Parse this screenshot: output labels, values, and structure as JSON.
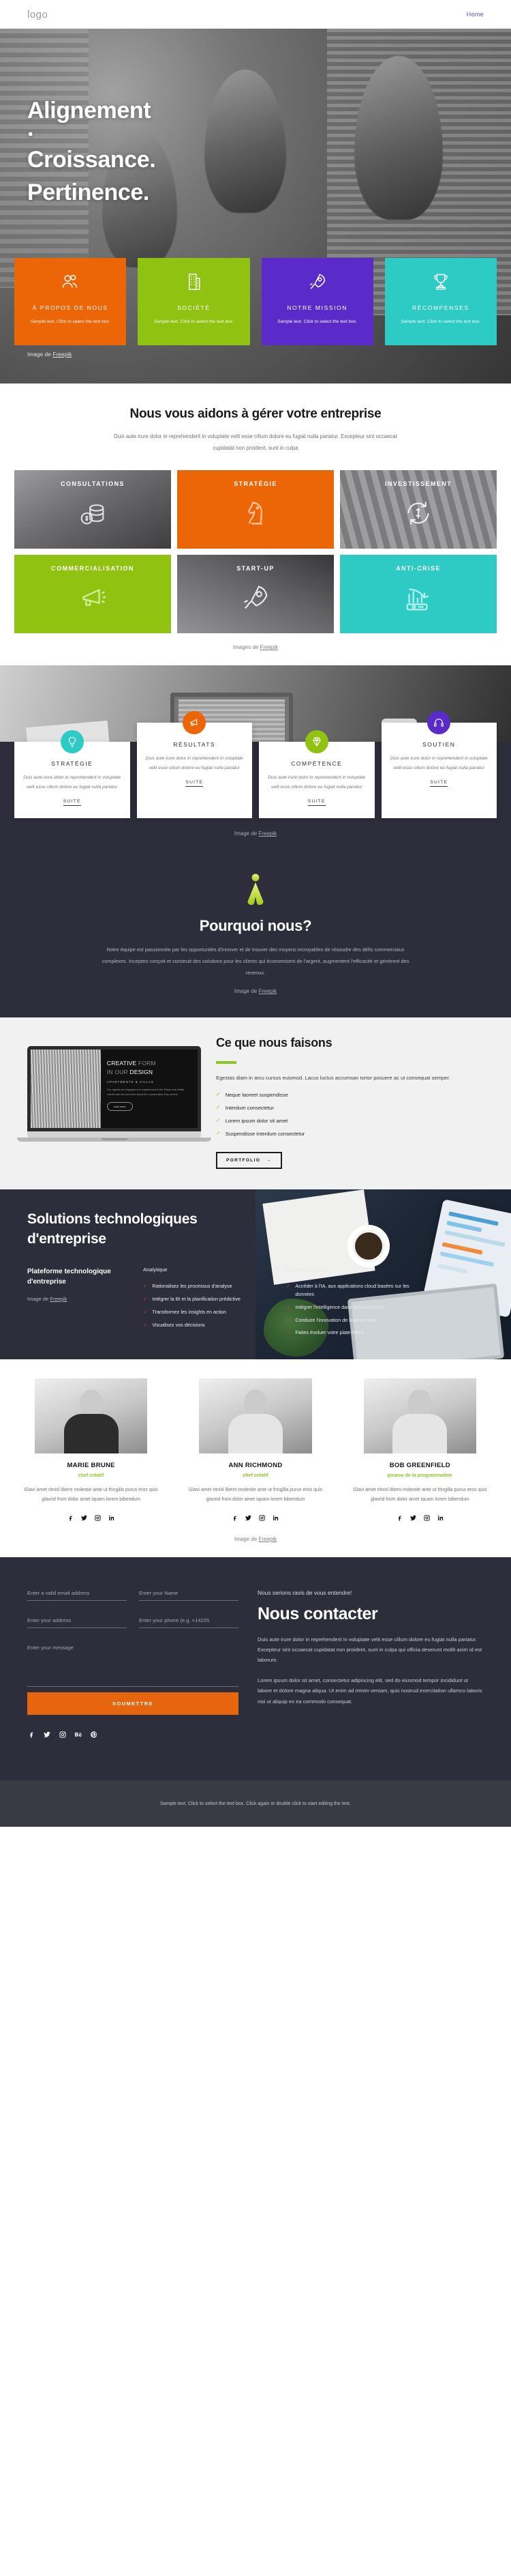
{
  "nav": {
    "logo": "logo",
    "links": [
      {
        "label": "Home"
      }
    ]
  },
  "hero": {
    "title_line1": "Alignement",
    "title_dot": "·",
    "title_line2": "Croissance.",
    "title_line3": "Pertinence.",
    "credit_prefix": "Image de ",
    "credit_link": "Freepik",
    "cards": [
      {
        "icon": "users-icon",
        "title": "À PROPOS DE NOUS",
        "text": "Sample text. Click to select the text box.",
        "color": "#ec6608"
      },
      {
        "icon": "building-icon",
        "title": "SOCIÉTÉ",
        "text": "Sample text. Click to select the text box.",
        "color": "#8fc211"
      },
      {
        "icon": "rocket-icon",
        "title": "NOTRE MISSION",
        "text": "Sample text. Click to select the text box.",
        "color": "#5a2bc8"
      },
      {
        "icon": "trophy-icon",
        "title": "RÉCOMPENSES",
        "text": "Sample text. Click to select the text box.",
        "color": "#2ecac4"
      }
    ]
  },
  "help": {
    "heading": "Nous vous aidons à gérer votre entreprise",
    "paragraph": "Duis aute irure dolor in reprehenderit in voluptate velit esse cillum dolore eu fugiat nulla pariatur. Excepteur sint occaecat cupidatat non proident, sunt in culpa",
    "services": [
      {
        "label": "CONSULTATIONS",
        "icon": "coins-icon",
        "style": "photo"
      },
      {
        "label": "STRATÉGIE",
        "icon": "chess-knight-icon",
        "style": "solid",
        "color": "#ec6608"
      },
      {
        "label": "INVESTISSEMENT",
        "icon": "currency-exchange-icon",
        "style": "photo"
      },
      {
        "label": "COMMERCIALISATION",
        "icon": "megaphone-icon",
        "style": "solid",
        "color": "#8fc211"
      },
      {
        "label": "START-UP",
        "icon": "rocket-icon",
        "style": "photo"
      },
      {
        "label": "ANTI-CRISE",
        "icon": "chart-down-icon",
        "style": "solid",
        "color": "#2ecac4"
      }
    ],
    "credit_prefix": "Images de ",
    "credit_link": "Freepik"
  },
  "features": {
    "cards": [
      {
        "title": "STRATÉGIE",
        "icon": "bulb-icon",
        "circle_color": "#2ecac4",
        "text": "Duis aute irure dolor in reprehenderit in voluptate velit esse cillum dolore eu fugiat nulla pariatur",
        "more": "SUITE"
      },
      {
        "title": "RÉSULTATS",
        "icon": "megaphone-icon",
        "circle_color": "#ec6608",
        "text": "Duis aute irure dolor in reprehenderit in voluptate velit esse cillum dolore eu fugiat nulla pariatur",
        "more": "SUITE"
      },
      {
        "title": "COMPÉTENCE",
        "icon": "diamond-icon",
        "circle_color": "#8fc211",
        "text": "Duis aute irure dolor in reprehenderit in voluptate velit esse cillum dolore eu fugiat nulla pariatur",
        "more": "SUITE"
      },
      {
        "title": "SOUTIEN",
        "icon": "headset-icon",
        "circle_color": "#5a2bc8",
        "text": "Duis aute irure dolor in reprehenderit in voluptate velit esse cillum dolore eu fugiat nulla pariatur",
        "more": "SUITE"
      }
    ],
    "credit_prefix": "Image de ",
    "credit_link": "Freepik"
  },
  "why": {
    "heading": "Pourquoi nous?",
    "paragraph": "Notre équipe est passionnée par les opportunités d'innover et de trouver des moyens incroyables de résoudre des défis commerciaux complexes. Incepteo conçoit et construit des solutions pour les clients qui économisent de l'argent, augmentent l'efficacité et génèrent des revenus.",
    "credit_prefix": "Image de ",
    "credit_link": "Freepik"
  },
  "what_we_do": {
    "heading": "Ce que nous faisons",
    "lede": "Egestas diam in arcu cursus euismod. Lacus luctus accumsan tortor posuere ac ut consequat semper.",
    "items": [
      "Neque laoreet suspendisse",
      "Interdum consectetur",
      "Lorem ipsum dolor sit amet",
      "Suspendisse interdum consectetur"
    ],
    "button": "PORTFOLIO",
    "button_arrow": "→",
    "mockup": {
      "title_strong": "CREATIVE",
      "title_light": " FORM",
      "title_line2_light": "IN OUR ",
      "title_line2_strong": "DESIGN",
      "subtitle": "APARTMENTS & VILLAS",
      "body": "Our agents are engaged and experienced in the Miami real estate market and are informed about the communities they service.",
      "cta": "read more"
    }
  },
  "tech": {
    "heading_line1": "Solutions technologiques",
    "heading_line2": "d'entreprise",
    "subheading": "Plateforme technologique d'entreprise",
    "credit_prefix": "Image de ",
    "credit_link": "Freepik",
    "col_analytics_title": "Analytique",
    "col_analytics_items": [
      "Rationalisez les processus d'analyse",
      "Intégrer la BI et la planification prédictive",
      "Transformez les insights en action",
      "Visualisez vos décisions"
    ],
    "col_tech_title": "Les technologies",
    "col_tech_items": [
      "Accéder à l'IA, aux applications cloud basées sur les données",
      "Intégrer l'intelligence dans les processus",
      "Conduire l'innovation de bout en bout",
      "Faites évoluer votre plate-forme"
    ]
  },
  "team": {
    "members": [
      {
        "name": "MARIE BRUNE",
        "role": "chef créatif",
        "bio": "Glavi amet ritnisl libero molestie ante ut fringilla purus eros quis glavrid from dolor amet iquam lorem bibendum"
      },
      {
        "name": "ANN RICHMOND",
        "role": "chef créatif",
        "bio": "Glavi amet ritnisl libero molestie ante ut fringilla purus eros quis glavrid from dolor amet iquam lorem bibendum"
      },
      {
        "name": "BOB GREENFIELD",
        "role": "gourou de la programmation",
        "bio": "Glavi amet ritnisl libero molestie ante ut fringilla purus eros quis glavrid from dolor amet iquam lorem bibendum"
      }
    ],
    "socials": [
      "facebook-icon",
      "twitter-icon",
      "instagram-icon",
      "linkedin-icon"
    ],
    "credit_prefix": "Image de ",
    "credit_link": "Freepik"
  },
  "contact": {
    "placeholders": {
      "email": "Enter a valid email address",
      "name": "Enter your Name",
      "address": "Enter your address",
      "phone": "Enter your phone (e.g. +14155",
      "message": "Enter your message"
    },
    "values": {
      "email": "",
      "name": "",
      "address": "",
      "phone": "",
      "message": ""
    },
    "submit": "SOUMETTRE",
    "socials": [
      "facebook-icon",
      "twitter-icon",
      "instagram-icon",
      "behance-icon",
      "pinterest-icon"
    ],
    "kicker": "Nous serions ravis de vous entendre!",
    "heading": "Nous contacter",
    "paragraph1": "Duis aute irure dolor in reprehenderit in voluptate velit esse cillum dolore eu fugiat nulla pariatur. Excepteur sint occaecat cupidatat non proident, sunt in culpa qui officia deserunt mollit anim id est laborum.",
    "paragraph2": "Lorem ipsum dolor sit amet, consectetur adipiscing elit, sed do eiusmod tempor incididunt ut labore et dolore magna aliqua. Ut enim ad minim veniam, quis nostrud exercitation ullamco laboris nisi ut aliquip ex ea commodo consequat."
  },
  "footer": {
    "text": "Sample text. Click to select the text box. Click again or double click to start editing the text."
  },
  "colors": {
    "orange": "#ec6608",
    "green": "#8fc211",
    "purple": "#5a2bc8",
    "teal": "#2ecac4",
    "dark": "#2e2d3c",
    "footer": "#3a3a44",
    "accent_link": "#5b49c9",
    "red_check": "#e03b2f"
  }
}
